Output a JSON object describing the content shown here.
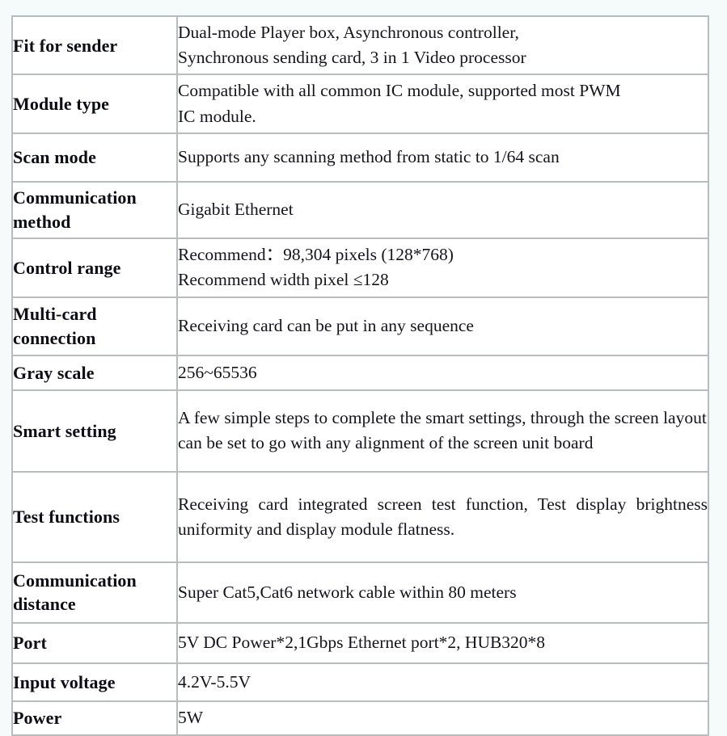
{
  "page": {
    "background_color": "#f5fbfb",
    "table_border_color": "#b9bcbc",
    "cell_background_color": "#ffffff",
    "text_color": "#14141c"
  },
  "spec_table": {
    "rows": [
      {
        "label": "Fit for sender",
        "value_lines": [
          "Dual-mode Player box, Asynchronous controller,",
          "Synchronous sending card, 3 in 1 Video processor"
        ],
        "justified": false
      },
      {
        "label": "Module type",
        "value_lines": [
          "Compatible with all common IC module, supported most PWM",
          "IC module."
        ],
        "justified": false
      },
      {
        "label": "Scan mode",
        "value_lines": [
          "Supports any scanning method from static to 1/64 scan"
        ],
        "justified": false
      },
      {
        "label": "Communication method",
        "value_lines": [
          "Gigabit Ethernet"
        ],
        "justified": false
      },
      {
        "label": "Control range",
        "value_lines": [
          "Recommend：98,304 pixels (128*768)",
          "Recommend width pixel ≤128"
        ],
        "justified": false
      },
      {
        "label": "Multi-card connection",
        "value_lines": [
          "Receiving card can be put in any sequence"
        ],
        "justified": false
      },
      {
        "label": "Gray scale",
        "value_lines": [
          "256~65536"
        ],
        "justified": false
      },
      {
        "label": "Smart setting",
        "value_lines": [
          "A few simple steps to complete the smart settings, through the screen layout can be set to go with any alignment of the screen unit board"
        ],
        "justified": false
      },
      {
        "label": "Test functions",
        "value_lines": [
          "Receiving card integrated screen test function, Test display brightness uniformity and display module flatness."
        ],
        "justified": true
      },
      {
        "label": "Communication distance",
        "value_lines": [
          "Super Cat5,Cat6 network cable within 80 meters"
        ],
        "justified": false
      },
      {
        "label": "Port",
        "value_lines": [
          "5V DC Power*2,1Gbps Ethernet port*2, HUB320*8"
        ],
        "justified": false
      },
      {
        "label": "Input voltage",
        "value_lines": [
          "4.2V-5.5V"
        ],
        "justified": false
      },
      {
        "label": "Power",
        "value_lines": [
          "5W"
        ],
        "justified": false
      }
    ]
  }
}
